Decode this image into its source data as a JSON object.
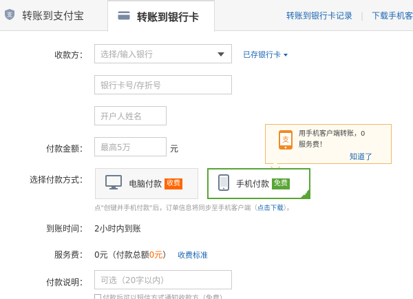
{
  "tabs": [
    {
      "label": "转账到支付宝"
    },
    {
      "label": "转账到银行卡"
    }
  ],
  "top_links": {
    "records": "转账到银行卡记录",
    "download": "下载手机客"
  },
  "form": {
    "payee_label": "收款方：",
    "bank_select_placeholder": "选择/输入银行",
    "saved_cards": "已存银行卡",
    "card_number_placeholder": "银行卡号/存折号",
    "account_name_placeholder": "开户人姓名",
    "amount_label": "付款金额：",
    "amount_placeholder": "最高5万",
    "amount_unit": "元",
    "method_label": "选择付款方式：",
    "method_pc": "电脑付款",
    "method_pc_badge": "收费",
    "method_mobile": "手机付款",
    "method_mobile_badge": "免费",
    "hint_text": "点\"创键并手机付款\"后，订单信息将同步至手机客户端（",
    "hint_link": "点击下载",
    "hint_end": "）。",
    "arrival_label": "到账时间：",
    "arrival_value": "2小时内到账",
    "fee_label": "服务费：",
    "fee_value_prefix": "0元（付款总额",
    "fee_value_amount": "0元",
    "fee_value_suffix": "）",
    "fee_standard": "收费标准",
    "note_label": "付款说明：",
    "note_placeholder": "可选（20字以内）",
    "notify_text": "付款后可以短信方式通知收款方（免费）"
  },
  "tooltip": {
    "line1": "用手机客户端转账，0",
    "line2": "服务费！",
    "ok": "知道了"
  },
  "colors": {
    "link": "#1a66b3",
    "selected_border": "#58a535",
    "fee_badge": "#ff6600",
    "tooltip_border": "#f0b866"
  }
}
